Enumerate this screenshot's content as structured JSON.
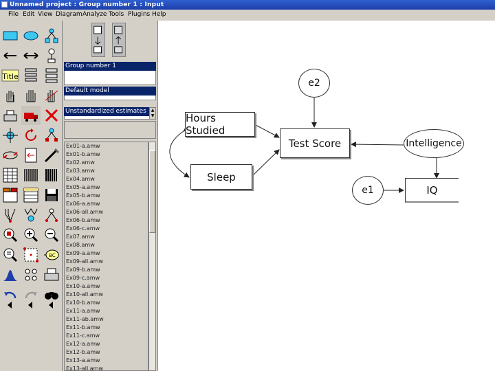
{
  "title": "Unnamed project : Group number 1 : Input",
  "menu": [
    "File",
    "Edit",
    "View",
    "Diagram",
    "Analyze",
    "Tools",
    "Plugins",
    "Help"
  ],
  "panel": {
    "group_label": "Group number 1",
    "model_label": "Default model",
    "estimates_label": "Unstandardized estimates",
    "files": [
      "Ex01-a.amw",
      "Ex01-b.amw",
      "Ex02.amw",
      "Ex03.amw",
      "Ex04.amw",
      "Ex05-a.amw",
      "Ex05-b.amw",
      "Ex06-a.amw",
      "Ex06-all.amw",
      "Ex06-b.amw",
      "Ex06-c.amw",
      "Ex07.amw",
      "Ex08.amw",
      "Ex09-a.amw",
      "Ex09-all.amw",
      "Ex09-b.amw",
      "Ex09-c.amw",
      "Ex10-a.amw",
      "Ex10-all.amw",
      "Ex10-b.amw",
      "Ex11-a.amw",
      "Ex11-ab.amw",
      "Ex11-b.amw",
      "Ex11-c.amw",
      "Ex12-a.amw",
      "Ex12-b.amw",
      "Ex13-a.amw",
      "Ex13-all.amw"
    ]
  },
  "toolbox": {
    "title_tool": "Title",
    "icons": [
      "rectangle-icon",
      "ellipse-icon",
      "indicator-icon",
      "single-arrow-icon",
      "double-arrow-icon",
      "unique-variable-icon",
      "title-icon",
      "list-variables-icon",
      "list-objects-icon",
      "select-one-icon",
      "select-all-icon",
      "deselect-icon",
      "copy-icon",
      "move-icon",
      "erase-icon",
      "move-parameter-icon",
      "rotate-icon",
      "reflect-icon",
      "shape-icon",
      "text-output-icon",
      "fit-icon",
      "analysis-properties-icon",
      "calculate-icon",
      "view-text-icon",
      "save-icon",
      "object-properties-icon",
      "drag-properties-icon",
      "preserve-symmetries-icon",
      "zoom-select-icon",
      "zoom-in-icon",
      "zoom-out-icon",
      "page-view-icon",
      "resize-icon",
      "bayesian-icon",
      "normal-curve-icon",
      "degrees-icon",
      "print-icon",
      "undo-icon",
      "redo-icon",
      "search-icon",
      "left-triangle-icon",
      "left-triangle-icon",
      "left-triangle-icon"
    ]
  },
  "diagram": {
    "observed": [
      {
        "id": "hours",
        "label": "Hours Studied"
      },
      {
        "id": "sleep",
        "label": "Sleep"
      },
      {
        "id": "score",
        "label": "Test Score"
      },
      {
        "id": "iq",
        "label": "IQ"
      }
    ],
    "latent": [
      {
        "id": "e2",
        "label": "e2"
      },
      {
        "id": "intel",
        "label": "Intelligence"
      },
      {
        "id": "e1",
        "label": "e1"
      }
    ]
  },
  "colors": {
    "selection": "#0a246a",
    "titlebar": "#1c3fa8",
    "background": "#d4d0c8"
  }
}
